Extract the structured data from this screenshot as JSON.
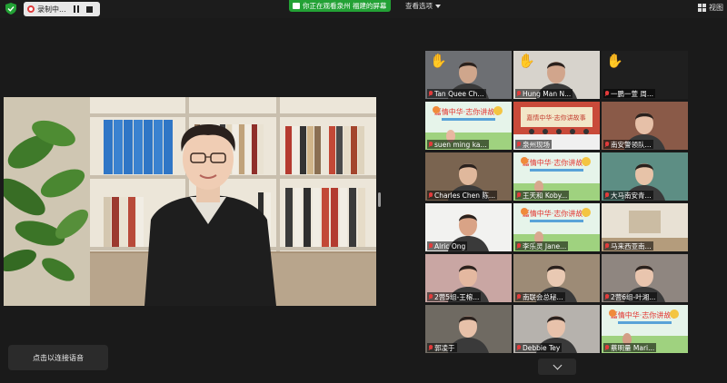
{
  "topbar": {
    "recording_label": "录制中...",
    "share_banner": "你正在观看泉州 福建的屏幕",
    "view_options": "查看选项",
    "view_button": "视图"
  },
  "main_speaker": {
    "description": "speaker video"
  },
  "gallery": [
    {
      "name": "Tan Quee Ch...",
      "hand": true,
      "kind": "person"
    },
    {
      "name": "Hung Man N...",
      "hand": true,
      "kind": "person"
    },
    {
      "name": "一鹏一萱  周...",
      "hand": true,
      "kind": "blank"
    },
    {
      "name": "suen ming ka...",
      "hand": false,
      "kind": "banner"
    },
    {
      "name": "泉州现场",
      "hand": false,
      "kind": "stage"
    },
    {
      "name": "南安警领队...",
      "hand": false,
      "kind": "person"
    },
    {
      "name": "Charles Chen 陈...",
      "hand": false,
      "kind": "person"
    },
    {
      "name": "王天和 Koby...",
      "hand": false,
      "kind": "banner"
    },
    {
      "name": "大马南安青...",
      "hand": false,
      "kind": "person"
    },
    {
      "name": "Alric Ong",
      "hand": false,
      "kind": "person"
    },
    {
      "name": "李乐灵 Jane...",
      "hand": false,
      "kind": "banner"
    },
    {
      "name": "马来西亚南...",
      "hand": false,
      "kind": "room"
    },
    {
      "name": "2营5组-王榕...",
      "hand": false,
      "kind": "person"
    },
    {
      "name": "南联会总秘...",
      "hand": false,
      "kind": "person"
    },
    {
      "name": "2营6组-叶湘...",
      "hand": false,
      "kind": "person"
    },
    {
      "name": "郭凌于",
      "hand": false,
      "kind": "person"
    },
    {
      "name": "Debbie Tey",
      "hand": false,
      "kind": "person"
    },
    {
      "name": "蔡明量 Mari...",
      "hand": false,
      "kind": "banner"
    }
  ],
  "audio_tip": "点击以连接语音"
}
